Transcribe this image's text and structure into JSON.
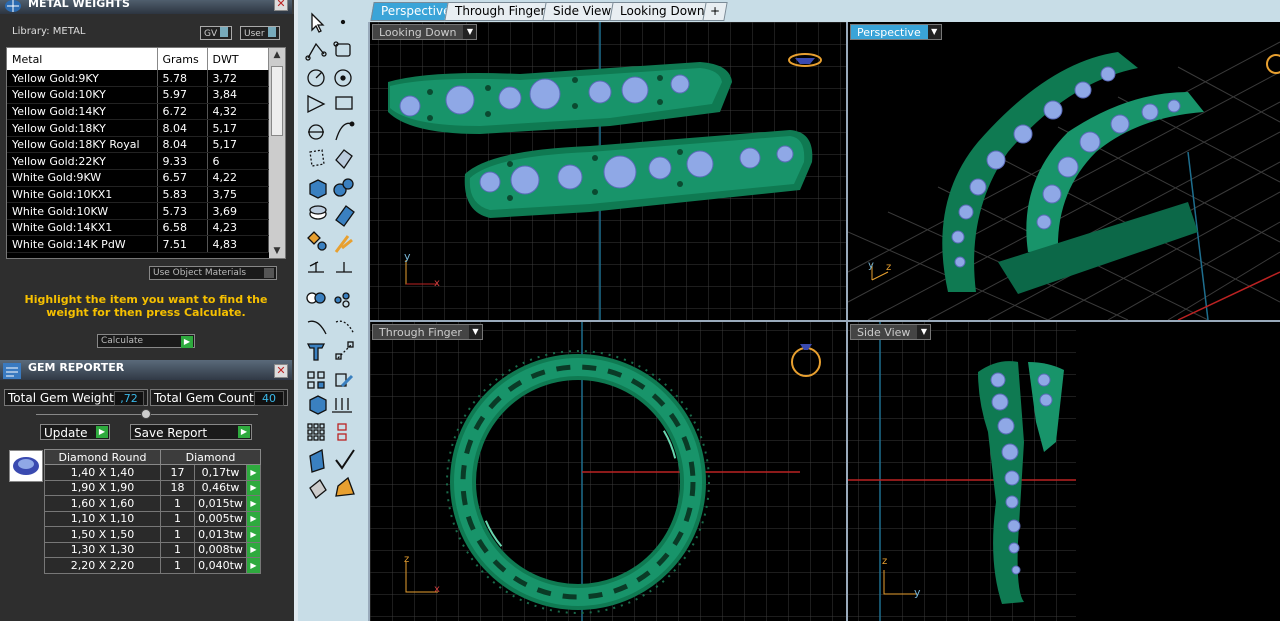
{
  "metal_weights": {
    "title": "METAL WEIGHTS",
    "library_label": "Library: METAL",
    "gv_label": "GV",
    "user_label": "User",
    "columns": [
      "Metal",
      "Grams",
      "DWT"
    ],
    "rows": [
      [
        "Yellow Gold:9KY",
        "5.78",
        "3,72"
      ],
      [
        "Yellow Gold:10KY",
        "5.97",
        "3,84"
      ],
      [
        "Yellow Gold:14KY",
        "6.72",
        "4,32"
      ],
      [
        "Yellow Gold:18KY",
        "8.04",
        "5,17"
      ],
      [
        "Yellow Gold:18KY Royal",
        "8.04",
        "5,17"
      ],
      [
        "Yellow Gold:22KY",
        "9.33",
        "6"
      ],
      [
        "White Gold:9KW",
        "6.57",
        "4,22"
      ],
      [
        "White Gold:10KX1",
        "5.83",
        "3,75"
      ],
      [
        "White Gold:10KW",
        "5.73",
        "3,69"
      ],
      [
        "White Gold:14KX1",
        "6.58",
        "4,23"
      ],
      [
        "White Gold:14K PdW",
        "7.51",
        "4,83"
      ]
    ],
    "use_object_materials": "Use Object Materials",
    "hint": "Highlight the item you want to find the weight for then press Calculate.",
    "calculate_label": "Calculate"
  },
  "gem_reporter": {
    "title": "GEM REPORTER",
    "total_weight_label": "Total Gem Weight",
    "total_weight_value": ",72",
    "total_count_label": "Total Gem Count",
    "total_count_value": "40",
    "update_label": "Update",
    "save_report_label": "Save Report",
    "header_shape": "Diamond Round",
    "header_material": "Diamond",
    "rows": [
      [
        "1,40 X 1,40",
        "17",
        "0,17tw"
      ],
      [
        "1,90 X 1,90",
        "18",
        "0,46tw"
      ],
      [
        "1,60 X 1,60",
        "1",
        "0,015tw"
      ],
      [
        "1,10 X 1,10",
        "1",
        "0,005tw"
      ],
      [
        "1,50 X 1,50",
        "1",
        "0,013tw"
      ],
      [
        "1,30 X 1,30",
        "1",
        "0,008tw"
      ],
      [
        "2,20 X 2,20",
        "1",
        "0,040tw"
      ]
    ]
  },
  "tabs": [
    "Perspective",
    "Through Finger",
    "Side View",
    "Looking Down",
    "+"
  ],
  "viewports": {
    "looking_down": "Looking Down",
    "perspective": "Perspective",
    "through_finger": "Through Finger",
    "side_view": "Side View"
  },
  "axes": {
    "x": "x",
    "y": "y",
    "z": "z"
  },
  "colors": {
    "accent": "#3aa4d8",
    "ring": "#1a9a6a",
    "gem": "#8fa8e6",
    "hint": "#f6c000"
  }
}
